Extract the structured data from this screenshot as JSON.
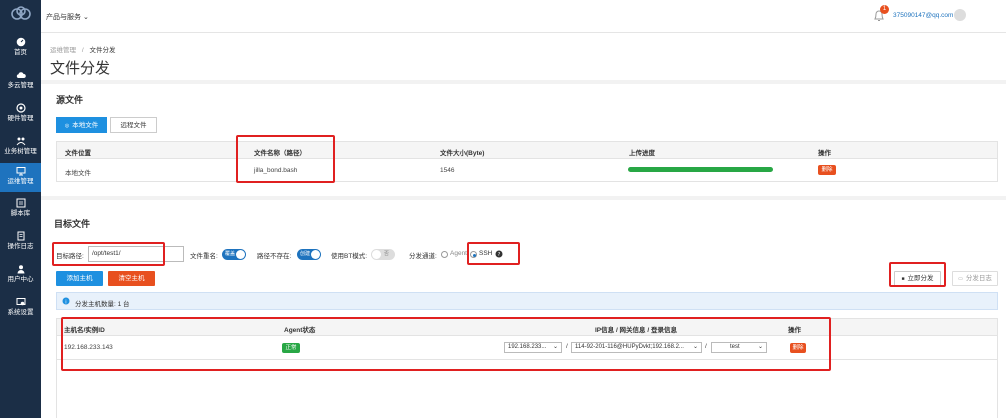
{
  "topbar": {
    "title": "产品与服务 ⌄",
    "badge": "1",
    "user": "375090147@qq.com"
  },
  "sidebar": {
    "items": [
      {
        "label": "首页",
        "icon": "dashboard-icon"
      },
      {
        "label": "多云管理",
        "icon": "cloud-icon"
      },
      {
        "label": "硬件管理",
        "icon": "hardware-icon"
      },
      {
        "label": "业务树管理",
        "icon": "tree-icon"
      },
      {
        "label": "运维管理",
        "icon": "monitor-icon"
      },
      {
        "label": "脚本库",
        "icon": "script-icon"
      },
      {
        "label": "操作日志",
        "icon": "log-icon"
      },
      {
        "label": "用户中心",
        "icon": "user-icon"
      },
      {
        "label": "系统设置",
        "icon": "settings-icon"
      }
    ]
  },
  "breadcrumb": {
    "parent": "运维管理",
    "sep": "/",
    "current": "文件分发"
  },
  "page_title": "文件分发",
  "source": {
    "title": "源文件",
    "tabs": [
      "本地文件",
      "远程文件"
    ],
    "columns": [
      "文件位置",
      "文件名称（路径）",
      "文件大小(Byte)",
      "上传进度",
      "操作"
    ],
    "row": {
      "location": "本地文件",
      "name": "jilla_bond.bash",
      "size": "1546",
      "progress": 1.0,
      "action": "删除"
    }
  },
  "target": {
    "title": "目标文件",
    "path_label": "目标路径:",
    "path_value": "/opt/test1/",
    "rename_label": "文件重名:",
    "rename_toggle": "覆盖",
    "not_exist_label": "路径不存在:",
    "not_exist_toggle": "创建",
    "bt_label": "使用BT模式:",
    "bt_toggle": "否",
    "channel_label": "分发通道:",
    "channel_agent": "Agent",
    "channel_ssh": "SSH",
    "add_host": "添加主机",
    "clear_host": "清空主机",
    "distribute": "立即分发",
    "log": "分发日志",
    "info": "分发主机数量: 1 台"
  },
  "hosts": {
    "columns": [
      "主机名/实例ID",
      "Agent状态",
      "IP信息 / 网关信息 / 登录信息",
      "操作"
    ],
    "row": {
      "host": "192.168.233.143",
      "status": "正常",
      "ip": "192.168.233...",
      "sep1": "/",
      "gateway": "114-92-201-116@HUPyDvkt;192.168.2...",
      "sep2": "/",
      "login": "test",
      "action": "删除"
    }
  },
  "colors": {
    "sidebar": "#1b2e46",
    "accent": "#1e73be",
    "danger": "#e8501f",
    "success": "#28a745",
    "highlight": "#e02020"
  }
}
